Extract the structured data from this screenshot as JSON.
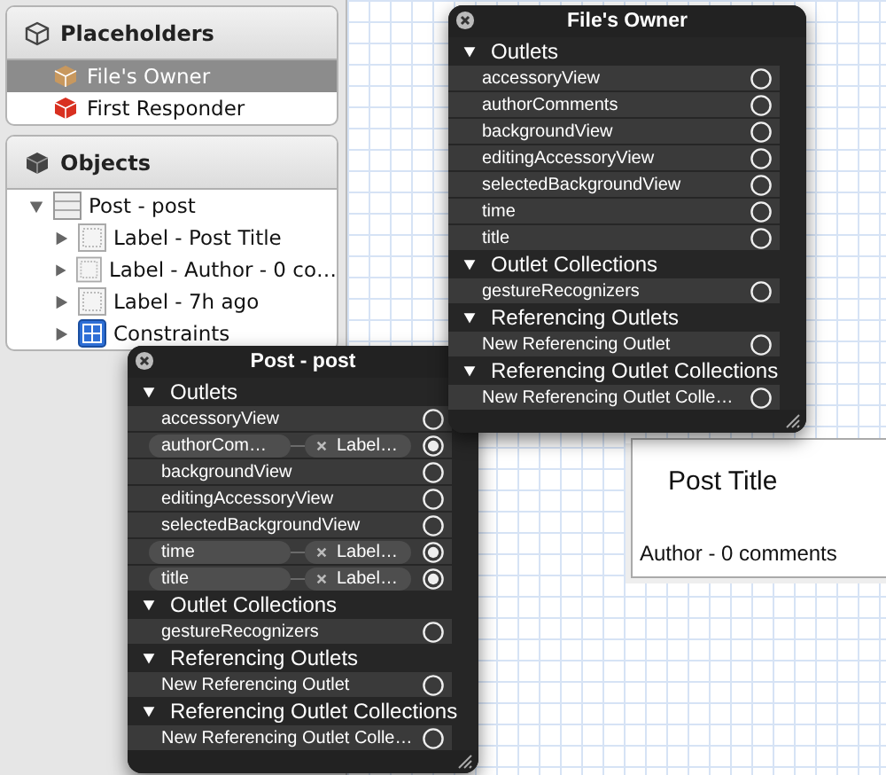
{
  "sidebar": {
    "placeholders": {
      "title": "Placeholders",
      "items": [
        {
          "label": "File's Owner",
          "kind": "owner",
          "selected": true
        },
        {
          "label": "First Responder",
          "kind": "responder",
          "selected": false
        }
      ]
    },
    "objects": {
      "title": "Objects",
      "tree": [
        {
          "label": "Post - post",
          "kind": "cell",
          "expanded": true,
          "children": [
            {
              "label": "Label - Post Title",
              "kind": "label",
              "expanded": false
            },
            {
              "label": "Label - Author - 0 co…",
              "kind": "label",
              "expanded": false
            },
            {
              "label": "Label - 7h ago",
              "kind": "label",
              "expanded": false
            },
            {
              "label": "Constraints",
              "kind": "constraints",
              "expanded": false
            }
          ]
        }
      ]
    }
  },
  "canvas": {
    "cell": {
      "title": "Post Title",
      "subtitle": "Author - 0 comments"
    }
  },
  "panels": [
    {
      "title": "File's Owner",
      "sections": [
        {
          "title": "Outlets",
          "expanded": true,
          "rows": [
            {
              "name": "accessoryView",
              "connected": false
            },
            {
              "name": "authorComments",
              "connected": false
            },
            {
              "name": "backgroundView",
              "connected": false
            },
            {
              "name": "editingAccessoryView",
              "connected": false
            },
            {
              "name": "selectedBackgroundView",
              "connected": false
            },
            {
              "name": "time",
              "connected": false
            },
            {
              "name": "title",
              "connected": false
            }
          ]
        },
        {
          "title": "Outlet Collections",
          "expanded": true,
          "rows": [
            {
              "name": "gestureRecognizers",
              "connected": false
            }
          ]
        },
        {
          "title": "Referencing Outlets",
          "expanded": true,
          "rows": [
            {
              "name": "New Referencing Outlet",
              "connected": false
            }
          ]
        },
        {
          "title": "Referencing Outlet Collections",
          "expanded": true,
          "rows": [
            {
              "name": "New Referencing Outlet Colle…",
              "connected": false
            }
          ]
        }
      ]
    },
    {
      "title": "Post - post",
      "sections": [
        {
          "title": "Outlets",
          "expanded": true,
          "rows": [
            {
              "name": "accessoryView",
              "connected": false
            },
            {
              "name": "authorCom…",
              "connected": true,
              "target": "Label…"
            },
            {
              "name": "backgroundView",
              "connected": false
            },
            {
              "name": "editingAccessoryView",
              "connected": false
            },
            {
              "name": "selectedBackgroundView",
              "connected": false
            },
            {
              "name": "time",
              "connected": true,
              "target": "Label…"
            },
            {
              "name": "title",
              "connected": true,
              "target": "Label…"
            }
          ]
        },
        {
          "title": "Outlet Collections",
          "expanded": true,
          "rows": [
            {
              "name": "gestureRecognizers",
              "connected": false
            }
          ]
        },
        {
          "title": "Referencing Outlets",
          "expanded": true,
          "rows": [
            {
              "name": "New Referencing Outlet",
              "connected": false
            }
          ]
        },
        {
          "title": "Referencing Outlet Collections",
          "expanded": true,
          "rows": [
            {
              "name": "New Referencing Outlet Colle…",
              "connected": false
            }
          ]
        }
      ]
    }
  ]
}
